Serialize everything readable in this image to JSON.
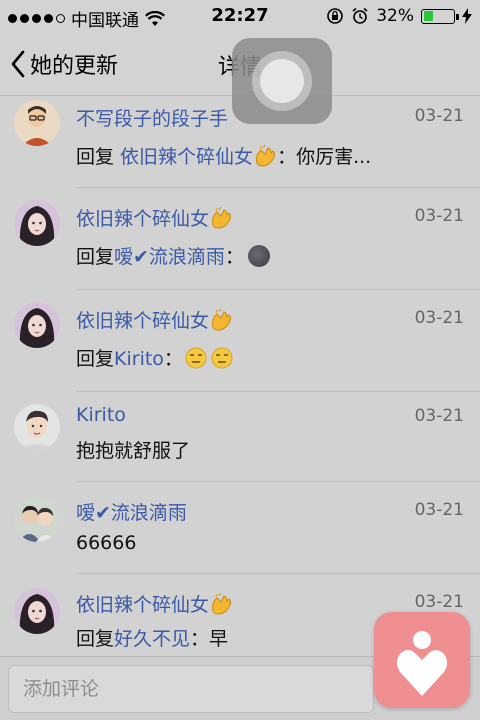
{
  "status_bar": {
    "carrier": "中国联通",
    "time": "22:27",
    "battery": "32%",
    "battery_level": 0.32,
    "signal_dots_filled": 4,
    "signal_dots_total": 5
  },
  "nav": {
    "back_label": "她的更新",
    "title": "详情"
  },
  "items": [
    {
      "name": "不写段子的段子手",
      "name_emoji": "",
      "date": "03-21",
      "prefix": "回复 ",
      "target": "依旧辣个碎仙女",
      "target_emoji": "clap",
      "body": "：你厉害...",
      "face_emoji": ""
    },
    {
      "name": "依旧辣个碎仙女",
      "name_emoji": "clap",
      "date": "03-21",
      "prefix": "回复",
      "target": "嗳✔流浪滴雨",
      "target_emoji": "",
      "body": "：",
      "face_emoji": "new-moon"
    },
    {
      "name": "依旧辣个碎仙女",
      "name_emoji": "clap",
      "date": "03-21",
      "prefix": "回复",
      "target": "Kirito",
      "target_emoji": "",
      "body": "：",
      "face_emoji": "unamused-x2"
    },
    {
      "name": "Kirito",
      "name_emoji": "",
      "date": "03-21",
      "prefix": "",
      "target": "",
      "target_emoji": "",
      "body": "抱抱就舒服了",
      "face_emoji": ""
    },
    {
      "name": "嗳✔流浪滴雨",
      "name_emoji": "",
      "date": "03-21",
      "prefix": "",
      "target": "",
      "target_emoji": "",
      "body": "66666",
      "face_emoji": ""
    },
    {
      "name": "依旧辣个碎仙女",
      "name_emoji": "clap",
      "date": "03-21",
      "prefix": "回复",
      "target": "好久不见",
      "target_emoji": "",
      "body": "：早",
      "face_emoji": ""
    }
  ],
  "comment": {
    "placeholder": "添加评论"
  },
  "colors": {
    "link": "#3b5aa6",
    "background": "#d2d2d2",
    "fab": "#ef8f92"
  }
}
